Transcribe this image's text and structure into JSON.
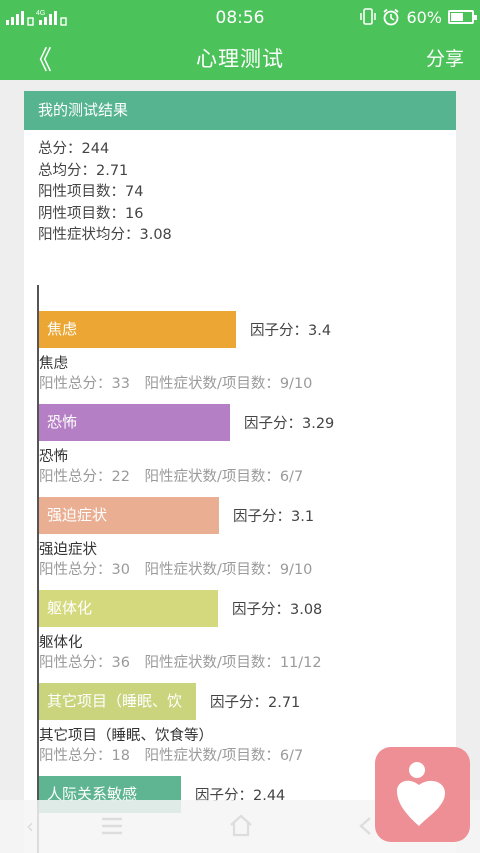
{
  "status_bar": {
    "network": "4G",
    "time": "08:56",
    "battery": "60%",
    "battery_level": 0.6
  },
  "nav": {
    "back_icon": "chevron-left-icon",
    "back_glyph": "《",
    "title": "心理测试",
    "share": "分享"
  },
  "result": {
    "header": "我的测试结果",
    "summary": [
      "总分：244",
      "总均分：2.71",
      "阳性项目数：74",
      "阴性项目数：16",
      "阳性症状均分：3.08"
    ]
  },
  "factors": [
    {
      "bar_label": "焦虑",
      "score": "因子分：3.4",
      "name": "焦虑",
      "detail": "阳性总分：33　阳性症状数/项目数：9/10",
      "value": 3.4,
      "color": "#eba634"
    },
    {
      "bar_label": "恐怖",
      "score": "因子分：3.29",
      "name": "恐怖",
      "detail": "阳性总分：22　阳性症状数/项目数：6/7",
      "value": 3.29,
      "color": "#b57fc5"
    },
    {
      "bar_label": "强迫症状",
      "score": "因子分：3.1",
      "name": "强迫症状",
      "detail": "阳性总分：30　阳性症状数/项目数：9/10",
      "value": 3.1,
      "color": "#eaae93"
    },
    {
      "bar_label": "躯体化",
      "score": "因子分：3.08",
      "name": "躯体化",
      "detail": "阳性总分：36　阳性症状数/项目数：11/12",
      "value": 3.08,
      "color": "#d5d97e"
    },
    {
      "bar_label": "其它项目（睡眠、饮",
      "score": "因子分：2.71",
      "name": "其它项目（睡眠、饮食等）",
      "detail": "阳性总分：18　阳性症状数/项目数：6/7",
      "value": 2.71,
      "color": "#c9d47c"
    },
    {
      "bar_label": "人际关系敏感",
      "score": "因子分：2.44",
      "name": "",
      "detail": "",
      "value": 2.44,
      "color": "#5fb592"
    }
  ],
  "bottom_nav": {
    "back_icon": "back-arrow-icon",
    "menu_icon": "menu-icon",
    "home_icon": "home-icon",
    "return_icon": "return-icon"
  },
  "fab": {
    "icon": "heart-person-icon"
  }
}
